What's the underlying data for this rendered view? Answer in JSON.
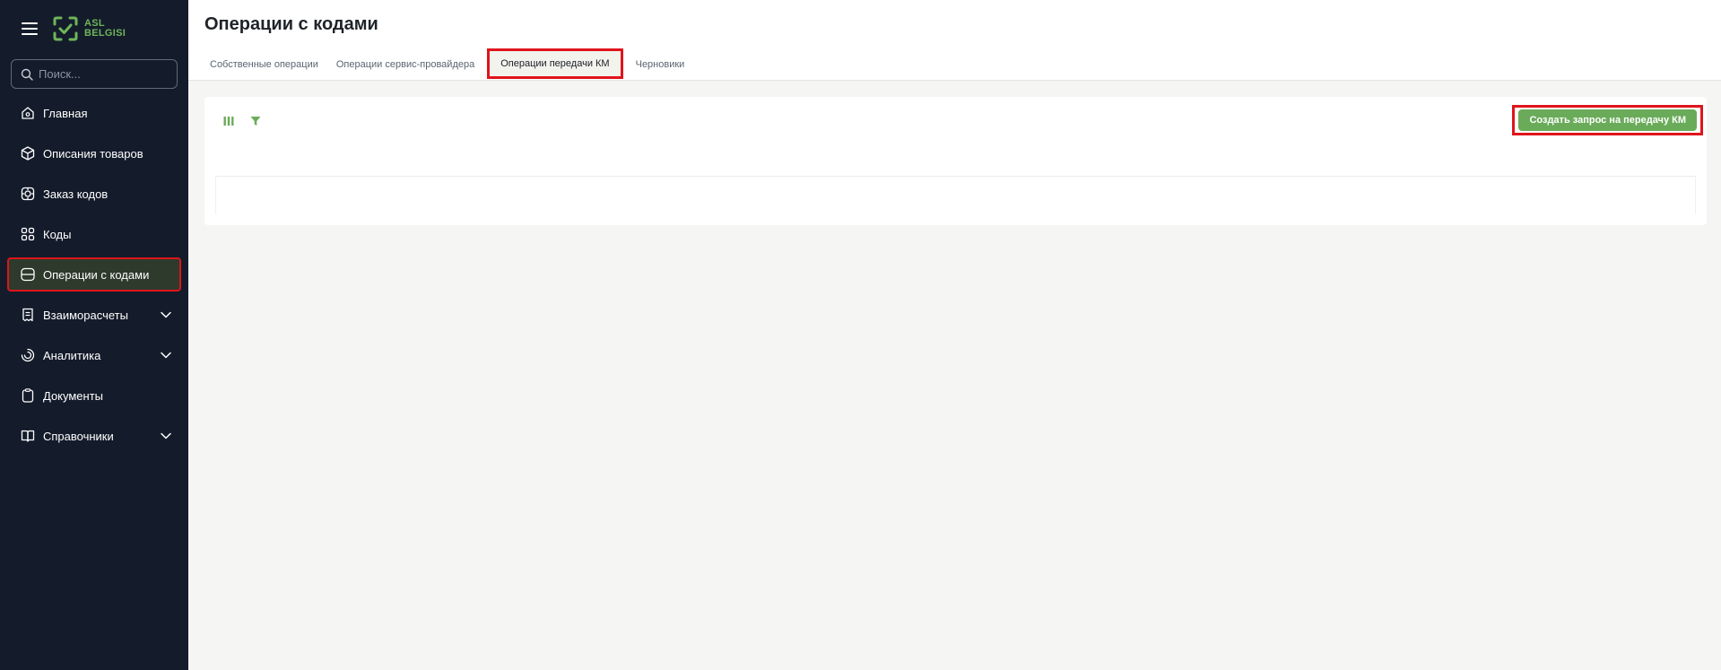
{
  "sidebar": {
    "logo_text_line1": "ASL",
    "logo_text_line2": "BELGISI",
    "search_placeholder": "Поиск...",
    "items": [
      {
        "label": "Главная",
        "icon": "home-icon"
      },
      {
        "label": "Описания товаров",
        "icon": "box-icon"
      },
      {
        "label": "Заказ кодов",
        "icon": "code-order-icon"
      },
      {
        "label": "Коды",
        "icon": "qr-codes-icon"
      },
      {
        "label": "Операции с кодами",
        "icon": "operations-icon",
        "active": true
      },
      {
        "label": "Взаиморасчеты",
        "icon": "receipt-icon",
        "expandable": true
      },
      {
        "label": "Аналитика",
        "icon": "analytics-icon",
        "expandable": true
      },
      {
        "label": "Документы",
        "icon": "clipboard-icon"
      },
      {
        "label": "Справочники",
        "icon": "book-icon",
        "expandable": true
      }
    ]
  },
  "header": {
    "title": "Операции с кодами",
    "tabs": [
      {
        "label": "Собственные операции"
      },
      {
        "label": "Операции сервис-провайдера"
      },
      {
        "label": "Операции передачи КМ",
        "active": true
      },
      {
        "label": "Черновики"
      }
    ]
  },
  "toolbar": {
    "create_button_label": "Создать запрос на передачу КМ",
    "icons": [
      "columns-icon",
      "filter-icon"
    ]
  },
  "colors": {
    "sidebar_bg": "#141c2b",
    "accent_green": "#6aab5a",
    "highlight_red": "#e0141b"
  }
}
